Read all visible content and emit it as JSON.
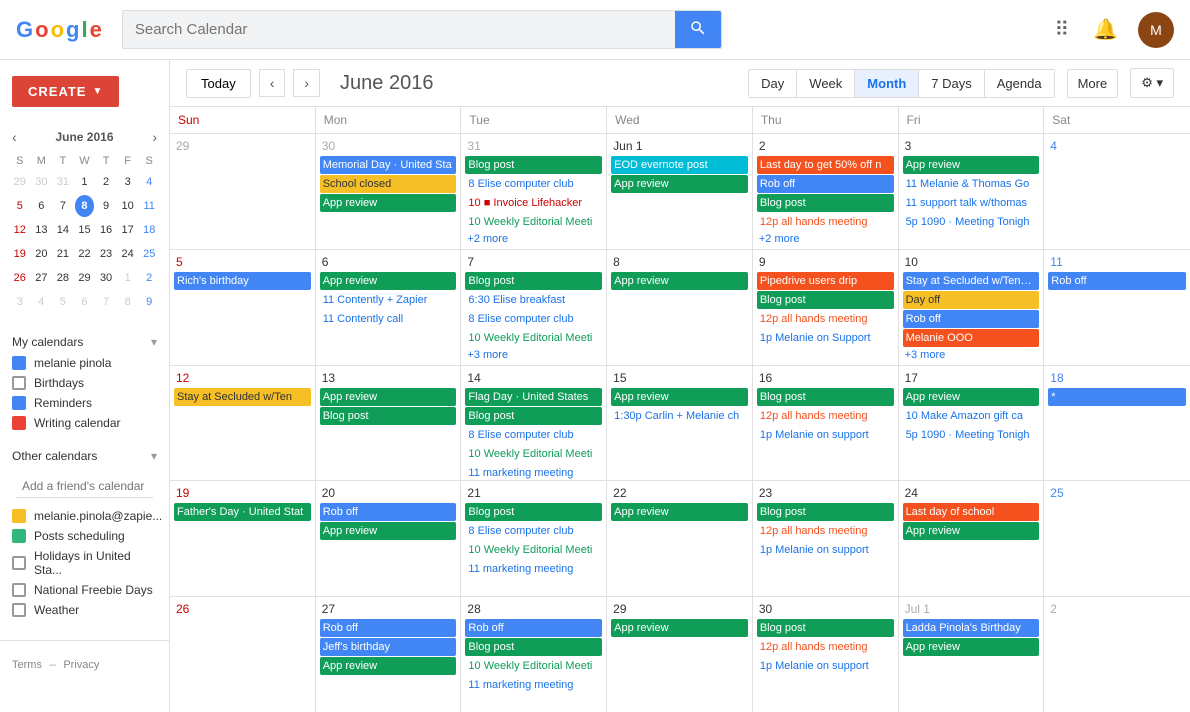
{
  "topBar": {
    "searchPlaceholder": "Search Calendar",
    "searchValue": ""
  },
  "sidebar": {
    "createLabel": "CREATE",
    "miniCal": {
      "title": "June 2016",
      "dayHeaders": [
        "S",
        "M",
        "T",
        "W",
        "T",
        "F",
        "S"
      ],
      "weeks": [
        [
          {
            "d": "29",
            "other": true
          },
          {
            "d": "30",
            "other": true
          },
          {
            "d": "31",
            "other": true
          },
          {
            "d": "1",
            "sun": false
          },
          {
            "d": "2",
            "sun": false
          },
          {
            "d": "3",
            "sun": false
          },
          {
            "d": "4",
            "sun": false,
            "sat": true
          }
        ],
        [
          {
            "d": "5"
          },
          {
            "d": "6"
          },
          {
            "d": "7"
          },
          {
            "d": "8",
            "today": true
          },
          {
            "d": "9"
          },
          {
            "d": "10"
          },
          {
            "d": "11",
            "sat": true
          }
        ],
        [
          {
            "d": "12"
          },
          {
            "d": "13"
          },
          {
            "d": "14"
          },
          {
            "d": "15"
          },
          {
            "d": "16"
          },
          {
            "d": "17"
          },
          {
            "d": "18",
            "sat": true
          }
        ],
        [
          {
            "d": "19"
          },
          {
            "d": "20"
          },
          {
            "d": "21"
          },
          {
            "d": "22"
          },
          {
            "d": "23"
          },
          {
            "d": "24"
          },
          {
            "d": "25",
            "sat": true
          }
        ],
        [
          {
            "d": "26"
          },
          {
            "d": "27"
          },
          {
            "d": "28"
          },
          {
            "d": "29"
          },
          {
            "d": "30"
          },
          {
            "d": "1",
            "other": true
          },
          {
            "d": "2",
            "other": true,
            "sat": true
          }
        ],
        [
          {
            "d": "3",
            "other": true
          },
          {
            "d": "4",
            "other": true
          },
          {
            "d": "5",
            "other": true
          },
          {
            "d": "6",
            "other": true
          },
          {
            "d": "7",
            "other": true
          },
          {
            "d": "8",
            "other": true
          },
          {
            "d": "9",
            "other": true,
            "sat": true
          }
        ]
      ]
    },
    "myCalendars": {
      "title": "My calendars",
      "items": [
        {
          "label": "melanie pinola",
          "color": "#4285F4",
          "checked": true
        },
        {
          "label": "Birthdays",
          "color": "",
          "checked": false
        },
        {
          "label": "Reminders",
          "color": "#4285F4",
          "checked": true
        },
        {
          "label": "Writing calendar",
          "color": "#EA4335",
          "checked": true
        }
      ]
    },
    "otherCalendars": {
      "title": "Other calendars",
      "addFriendPlaceholder": "Add a friend's calendar",
      "items": [
        {
          "label": "melanie.pinola@zapie...",
          "color": "#F6BF26",
          "checked": true
        },
        {
          "label": "Posts scheduling",
          "color": "#33B679",
          "checked": true
        },
        {
          "label": "Holidays in United Sta...",
          "color": "",
          "checked": false
        },
        {
          "label": "National Freebie Days",
          "color": "",
          "checked": false
        },
        {
          "label": "Weather",
          "color": "",
          "checked": false
        }
      ]
    },
    "footer": {
      "terms": "Terms",
      "privacy": "Privacy"
    }
  },
  "mainHeader": {
    "todayLabel": "Today",
    "title": "June 2016",
    "views": [
      "Day",
      "Week",
      "Month",
      "7 Days",
      "Agenda"
    ],
    "activeView": "Month",
    "moreLabel": "More",
    "settingsIcon": "⚙"
  },
  "calendar": {
    "dayHeaders": [
      "Sun",
      "Mon",
      "Tue",
      "Wed",
      "Thu",
      "Fri",
      "Sat"
    ],
    "weeks": [
      {
        "cells": [
          {
            "date": "29",
            "otherMonth": true,
            "events": []
          },
          {
            "date": "30",
            "otherMonth": true,
            "events": [
              {
                "label": "Memorial Day · United Sta",
                "type": "blue"
              },
              {
                "label": "School closed",
                "type": "yellow"
              },
              {
                "label": "App review",
                "type": "green"
              }
            ]
          },
          {
            "date": "31",
            "otherMonth": true,
            "events": [
              {
                "label": "Blog post",
                "type": "green"
              },
              {
                "label": "8 Elise computer club",
                "type": "blue-text"
              },
              {
                "label": "10 ■ Invoice Lifehacker",
                "type": "red-text"
              },
              {
                "label": "10 Weekly Editorial Meeti",
                "type": "green-text"
              },
              {
                "label": "+2 more",
                "type": "more"
              }
            ]
          },
          {
            "date": "Jun 1",
            "events": [
              {
                "label": "EOD evernote post",
                "type": "teal"
              },
              {
                "label": "App review",
                "type": "green"
              }
            ]
          },
          {
            "date": "2",
            "events": [
              {
                "label": "Last day to get 50% off n",
                "type": "orange"
              },
              {
                "label": "Rob off",
                "type": "blue"
              },
              {
                "label": "Blog post",
                "type": "green"
              },
              {
                "label": "12p all hands meeting",
                "type": "orange-text"
              },
              {
                "label": "+2 more",
                "type": "more"
              }
            ]
          },
          {
            "date": "3",
            "events": [
              {
                "label": "App review",
                "type": "green"
              },
              {
                "label": "11 Melanie & Thomas Go",
                "type": "blue-text"
              },
              {
                "label": "11 support talk w/thomas",
                "type": "blue-text"
              },
              {
                "label": "5p 1090 · Meeting Tonigh",
                "type": "blue-text"
              }
            ]
          },
          {
            "date": "4",
            "events": []
          }
        ]
      },
      {
        "cells": [
          {
            "date": "5",
            "events": [
              {
                "label": "Rich's birthday",
                "type": "blue"
              }
            ]
          },
          {
            "date": "6",
            "events": [
              {
                "label": "App review",
                "type": "green"
              },
              {
                "label": "11 Contently + Zapier",
                "type": "blue-text"
              },
              {
                "label": "11 Contently call",
                "type": "blue-text"
              }
            ]
          },
          {
            "date": "7",
            "events": [
              {
                "label": "Blog post",
                "type": "green"
              },
              {
                "label": "6:30 Elise breakfast",
                "type": "blue-text"
              },
              {
                "label": "8 Elise computer club",
                "type": "blue-text"
              },
              {
                "label": "10 Weekly Editorial Meeti",
                "type": "green-text"
              },
              {
                "label": "+3 more",
                "type": "more"
              }
            ]
          },
          {
            "date": "8",
            "events": [
              {
                "label": "App review",
                "type": "green"
              }
            ]
          },
          {
            "date": "9",
            "events": [
              {
                "label": "Pipedrive users drip",
                "type": "orange"
              },
              {
                "label": "Blog post",
                "type": "green"
              },
              {
                "label": "12p all hands meeting",
                "type": "orange-text"
              },
              {
                "label": "1p Melanie on Support",
                "type": "blue-text"
              }
            ]
          },
          {
            "date": "10",
            "events": [
              {
                "label": "Stay at Secluded w/Tennis/Koi Pond/Hot Tub · Secl",
                "type": "blue",
                "multi": true
              },
              {
                "label": "Day off",
                "type": "yellow"
              },
              {
                "label": "Rob off",
                "type": "blue"
              },
              {
                "label": "Melanie OOO",
                "type": "orange"
              },
              {
                "label": "+3 more",
                "type": "more"
              }
            ]
          },
          {
            "date": "11",
            "events": [
              {
                "label": "Rob off",
                "type": "blue"
              }
            ]
          }
        ]
      },
      {
        "cells": [
          {
            "date": "12",
            "events": [
              {
                "label": "Stay at Secluded w/Ten",
                "type": "yellow"
              }
            ]
          },
          {
            "date": "13",
            "events": [
              {
                "label": "App review",
                "type": "green"
              },
              {
                "label": "Blog post",
                "type": "green"
              }
            ]
          },
          {
            "date": "14",
            "events": [
              {
                "label": "Flag Day · United States",
                "type": "green"
              },
              {
                "label": "Blog post",
                "type": "green"
              },
              {
                "label": "8 Elise computer club",
                "type": "blue-text"
              },
              {
                "label": "10 Weekly Editorial Meeti",
                "type": "green-text"
              },
              {
                "label": "11 marketing meeting",
                "type": "blue-text"
              }
            ]
          },
          {
            "date": "15",
            "events": [
              {
                "label": "App review",
                "type": "green"
              },
              {
                "label": "1:30p Carlin + Melanie ch",
                "type": "blue-text"
              }
            ]
          },
          {
            "date": "16",
            "events": [
              {
                "label": "Blog post",
                "type": "green"
              },
              {
                "label": "12p all hands meeting",
                "type": "orange-text"
              },
              {
                "label": "1p Melanie on support",
                "type": "blue-text"
              }
            ]
          },
          {
            "date": "17",
            "events": [
              {
                "label": "App review",
                "type": "green"
              },
              {
                "label": "10 Make Amazon gift ca",
                "type": "blue-text"
              },
              {
                "label": "5p 1090 · Meeting Tonigh",
                "type": "blue-text"
              }
            ]
          },
          {
            "date": "18",
            "events": [
              {
                "label": "*",
                "type": "blue"
              }
            ]
          }
        ]
      },
      {
        "cells": [
          {
            "date": "19",
            "events": [
              {
                "label": "Father's Day · United Stat",
                "type": "green"
              }
            ]
          },
          {
            "date": "20",
            "events": [
              {
                "label": "Rob off",
                "type": "blue"
              },
              {
                "label": "App review",
                "type": "green"
              }
            ]
          },
          {
            "date": "21",
            "events": [
              {
                "label": "Blog post",
                "type": "green"
              },
              {
                "label": "8 Elise computer club",
                "type": "blue-text"
              },
              {
                "label": "10 Weekly Editorial Meeti",
                "type": "green-text"
              },
              {
                "label": "11 marketing meeting",
                "type": "blue-text"
              }
            ]
          },
          {
            "date": "22",
            "events": [
              {
                "label": "App review",
                "type": "green"
              }
            ]
          },
          {
            "date": "23",
            "events": [
              {
                "label": "Blog post",
                "type": "green"
              },
              {
                "label": "12p all hands meeting",
                "type": "orange-text"
              },
              {
                "label": "1p Melanie on support",
                "type": "blue-text"
              }
            ]
          },
          {
            "date": "24",
            "events": [
              {
                "label": "Last day of school",
                "type": "orange"
              },
              {
                "label": "App review",
                "type": "green"
              }
            ]
          },
          {
            "date": "25",
            "events": []
          }
        ]
      },
      {
        "cells": [
          {
            "date": "26",
            "events": []
          },
          {
            "date": "27",
            "events": [
              {
                "label": "Rob off",
                "type": "blue"
              },
              {
                "label": "Jeff's birthday",
                "type": "blue"
              },
              {
                "label": "App review",
                "type": "green"
              }
            ]
          },
          {
            "date": "28",
            "events": [
              {
                "label": "Rob off",
                "type": "blue"
              },
              {
                "label": "Blog post",
                "type": "green"
              },
              {
                "label": "10 Weekly Editorial Meeti",
                "type": "green-text"
              },
              {
                "label": "11 marketing meeting",
                "type": "blue-text"
              }
            ]
          },
          {
            "date": "29",
            "events": [
              {
                "label": "App review",
                "type": "green"
              }
            ]
          },
          {
            "date": "30",
            "events": [
              {
                "label": "Blog post",
                "type": "green"
              },
              {
                "label": "12p all hands meeting",
                "type": "orange-text"
              },
              {
                "label": "1p Melanie on support",
                "type": "blue-text"
              }
            ]
          },
          {
            "date": "Jul 1",
            "otherMonth": true,
            "events": [
              {
                "label": "Ladda Pinola's Birthday",
                "type": "blue"
              },
              {
                "label": "App review",
                "type": "green"
              }
            ]
          },
          {
            "date": "2",
            "otherMonth": true,
            "events": []
          }
        ]
      }
    ]
  }
}
